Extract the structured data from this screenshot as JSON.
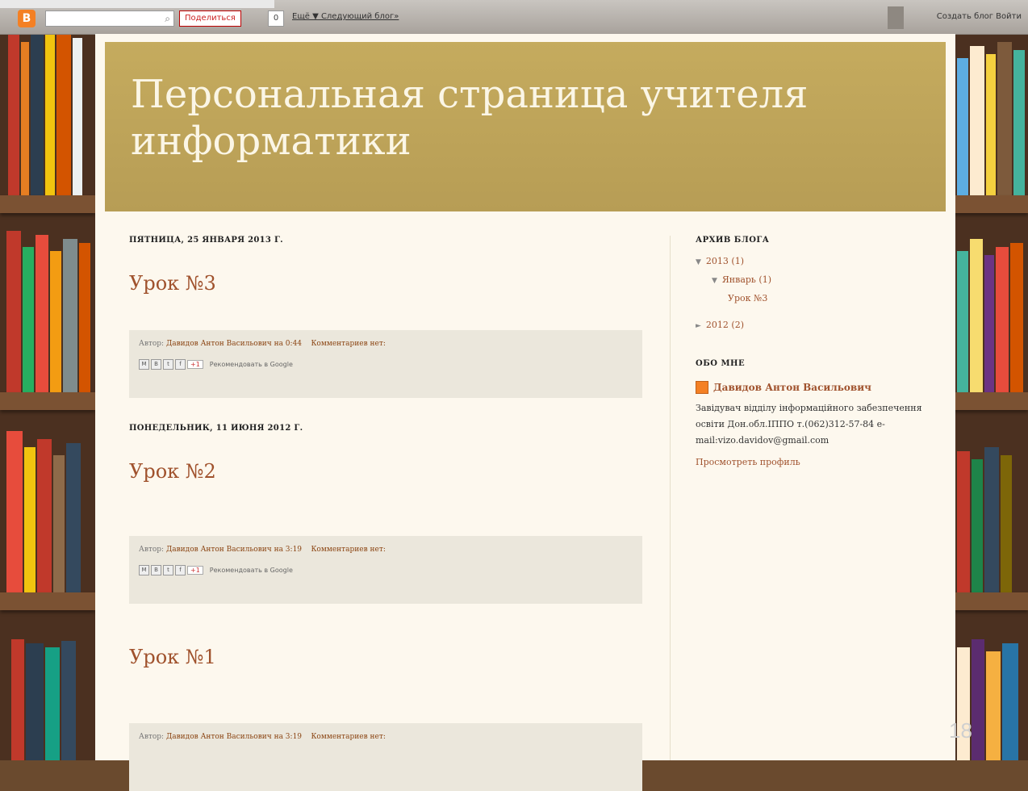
{
  "navbar": {
    "logo": "B",
    "search_icon": "search-icon",
    "share_label": "Поделиться",
    "count": "0",
    "next_blog": "Ещё ▼   Следующий блог»",
    "create_blog": "Создать блог   Войти"
  },
  "header": {
    "title": "Персональная страница учителя информатики"
  },
  "posts": [
    {
      "date": "ПЯТНИЦА, 25 ЯНВАРЯ 2013 Г.",
      "title": "Урок №3",
      "author_prefix": "Автор: ",
      "author": "Давидов Антон Васильович",
      "time": " на 0:44",
      "comments": "Комментариев нет:",
      "recommend": "Рекомендовать в Google"
    },
    {
      "date": "ПОНЕДЕЛЬНИК, 11 ИЮНЯ 2012 Г.",
      "title": "Урок №2",
      "author_prefix": "Автор: ",
      "author": "Давидов Антон Васильович",
      "time": " на 3:19",
      "comments": "Комментариев нет:",
      "recommend": "Рекомендовать в Google"
    },
    {
      "date": "",
      "title": "Урок №1",
      "author_prefix": "Автор: ",
      "author": "Давидов Антон Васильович",
      "time": " на 3:19",
      "comments": "Комментариев нет:",
      "recommend": ""
    }
  ],
  "sidebar": {
    "archive_title": "АРХИВ БЛОГА",
    "archive": [
      {
        "label": "2013 (1)",
        "arrow": "▼"
      },
      {
        "label": "Январь (1)",
        "arrow": "▼"
      },
      {
        "label": "Урок №3",
        "arrow": ""
      },
      {
        "label": "2012 (2)",
        "arrow": "►"
      }
    ],
    "about_title": "ОБО МНЕ",
    "profile_name": "Давидов Антон Васильович",
    "profile_desc": "Завідувач відділу інформаційного забезпечення освіти Дон.обл.ІППО т.(062)312-57-84 e-mail:vizo.davidov@gmail.com",
    "profile_link": "Просмотреть профиль"
  },
  "slide_number": "18"
}
